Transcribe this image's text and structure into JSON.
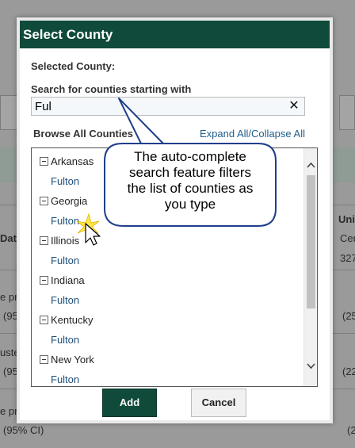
{
  "background": {
    "rows": [
      {
        "text": "Dat",
        "bold": true
      },
      {
        "text": "e pr",
        "bold": false
      },
      {
        "text": "(95",
        "bold": false
      },
      {
        "text": "uste",
        "bold": false
      },
      {
        "text": "(95",
        "bold": false
      },
      {
        "text": "e pr",
        "bold": false
      },
      {
        "text": "(95% CI)",
        "bold": false
      }
    ],
    "right": [
      {
        "text": "Uni",
        "bold": true
      },
      {
        "text": "Cer",
        "bold": false
      },
      {
        "text": "327",
        "bold": false
      },
      {
        "text": "(25",
        "bold": false
      },
      {
        "text": "(22",
        "bold": false
      },
      {
        "text": "(2",
        "bold": false
      }
    ]
  },
  "modal": {
    "title": "Select County",
    "selected_label": "Selected County:",
    "search_label": "Search for counties starting with",
    "search_value": "Ful",
    "clear_icon": "close-icon",
    "clear_glyph": "✕",
    "browse_label": "Browse All Counties",
    "expand_link": "Expand All/Collapse All",
    "tree": [
      {
        "state": "Arkansas",
        "county": "Fulton"
      },
      {
        "state": "Georgia",
        "county": "Fulton"
      },
      {
        "state": "Illinois",
        "county": "Fulton"
      },
      {
        "state": "Indiana",
        "county": "Fulton"
      },
      {
        "state": "Kentucky",
        "county": "Fulton"
      },
      {
        "state": "New York",
        "county": "Fulton"
      }
    ],
    "add_label": "Add",
    "cancel_label": "Cancel"
  },
  "callout": {
    "lines": [
      "The auto-complete",
      "search feature filters",
      "the list of counties as",
      "you type"
    ]
  },
  "colors": {
    "header_bg": "#0f4a3a",
    "link": "#1f5e8a",
    "callout_border": "#1f3f8a"
  }
}
